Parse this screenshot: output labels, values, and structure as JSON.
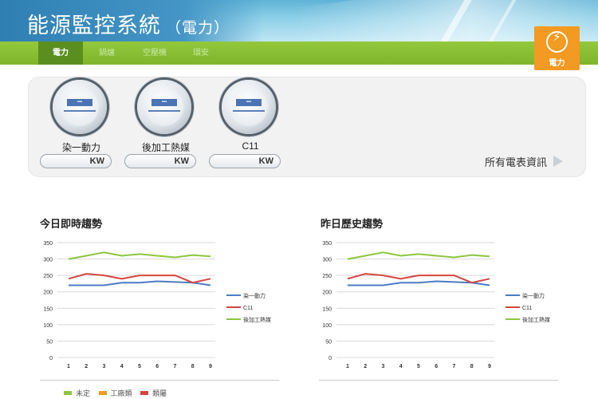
{
  "header": {
    "title": "能源監控系統",
    "subtitle": "（電力）"
  },
  "nav": {
    "tabs": [
      {
        "label": "電力",
        "active": true
      },
      {
        "label": "鍋爐",
        "active": false
      },
      {
        "label": "空壓機",
        "active": false
      },
      {
        "label": "環安",
        "active": false
      }
    ]
  },
  "badge": {
    "icon": "lightning-icon",
    "label": "電力",
    "color": "#f39a23"
  },
  "meters": [
    {
      "name": "染一動力",
      "unit": "KW",
      "icon": "electric-meter-icon"
    },
    {
      "name": "後加工熱媒",
      "unit": "KW",
      "icon": "electric-meter-icon"
    },
    {
      "name": "C11",
      "unit": "KW",
      "icon": "electric-meter-icon"
    }
  ],
  "all_meters_link": "所有電表資訊",
  "sections": {
    "today": "今日即時趨勢",
    "yesterday": "昨日歷史趨勢"
  },
  "bottom_legend": [
    {
      "label": "未定",
      "color": "#8dc63f"
    },
    {
      "label": "工廠類",
      "color": "#f39a23"
    },
    {
      "label": "類屬",
      "color": "#d64541"
    }
  ],
  "chart_data": [
    {
      "type": "line",
      "title": "今日即時趨勢",
      "x": [
        1,
        2,
        3,
        4,
        5,
        6,
        7,
        8,
        9
      ],
      "ylim": [
        0,
        350
      ],
      "yticks": [
        0,
        50,
        100,
        150,
        200,
        250,
        300,
        350
      ],
      "grid": true,
      "legend": "right",
      "series": [
        {
          "name": "染一動力",
          "color": "#4a7cc4",
          "values": [
            220,
            220,
            220,
            228,
            228,
            232,
            230,
            228,
            220
          ]
        },
        {
          "name": "C11",
          "color": "#d64541",
          "values": [
            240,
            255,
            250,
            240,
            250,
            250,
            250,
            228,
            240
          ]
        },
        {
          "name": "後加工熱媒",
          "color": "#8dc63f",
          "values": [
            300,
            310,
            320,
            310,
            315,
            310,
            305,
            312,
            308
          ]
        }
      ]
    },
    {
      "type": "line",
      "title": "昨日歷史趨勢",
      "x": [
        1,
        2,
        3,
        4,
        5,
        6,
        7,
        8,
        9
      ],
      "ylim": [
        0,
        350
      ],
      "yticks": [
        0,
        50,
        100,
        150,
        200,
        250,
        300,
        350
      ],
      "grid": true,
      "legend": "right",
      "series": [
        {
          "name": "染一動力",
          "color": "#4a7cc4",
          "values": [
            220,
            220,
            220,
            228,
            228,
            232,
            230,
            228,
            220
          ]
        },
        {
          "name": "C11",
          "color": "#d64541",
          "values": [
            240,
            255,
            250,
            240,
            250,
            250,
            250,
            228,
            240
          ]
        },
        {
          "name": "後加工熱媒",
          "color": "#8dc63f",
          "values": [
            300,
            310,
            320,
            310,
            315,
            310,
            305,
            312,
            308
          ]
        }
      ]
    }
  ]
}
